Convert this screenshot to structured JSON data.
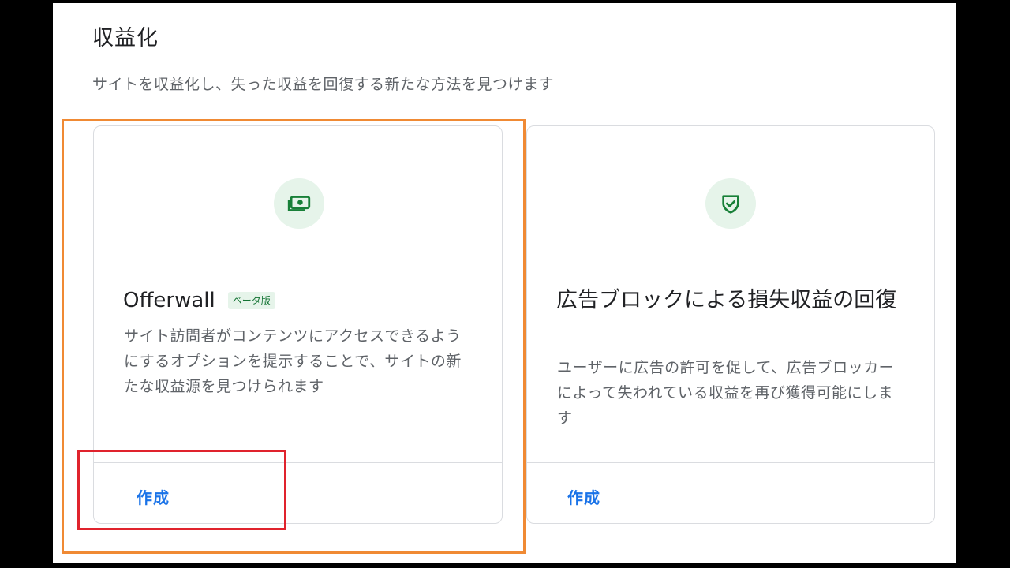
{
  "page": {
    "title": "収益化",
    "subtitle": "サイトを収益化し、失った収益を回復する新たな方法を見つけます"
  },
  "cards": [
    {
      "icon": "money-icon",
      "title": "Offerwall",
      "badge": "ベータ版",
      "description": "サイト訪問者がコンテンツにアクセスできるようにするオプションを提示することで、サイトの新たな収益源を見つけられます",
      "action_label": "作成"
    },
    {
      "icon": "shield-check-icon",
      "title": "広告ブロックによる損失収益の回復",
      "description": "ユーザーに広告の許可を促して、広告ブロッカーによって失われている収益を再び獲得可能にします",
      "action_label": "作成"
    }
  ],
  "colors": {
    "accent": "#1a73e8",
    "icon_green": "#188038",
    "icon_bg": "#e6f4ea",
    "highlight_orange": "#f08a34",
    "highlight_red": "#e0232d"
  }
}
